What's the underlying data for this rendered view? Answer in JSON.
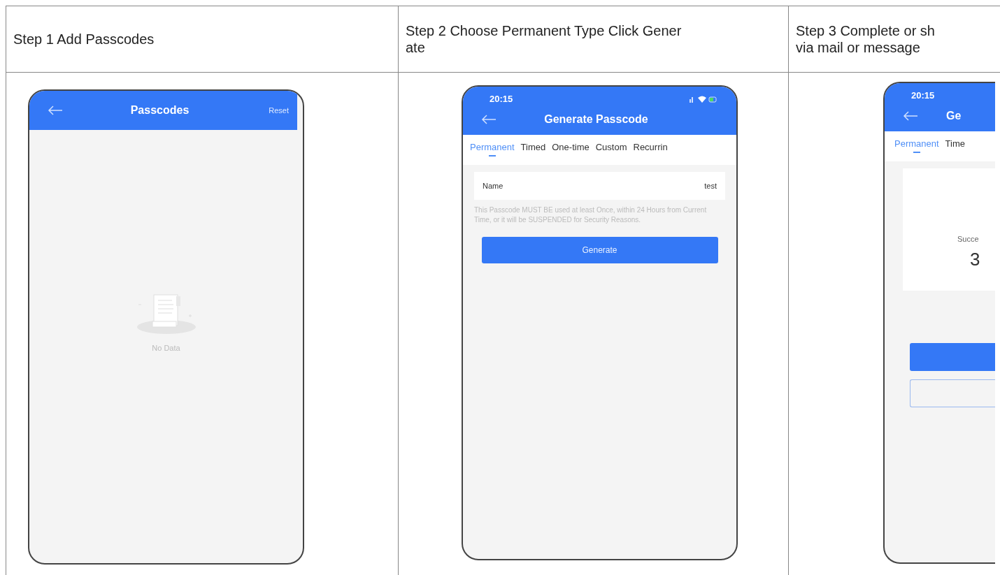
{
  "table": {
    "columns": [
      {
        "header": [
          "Step 1 Add Passcodes"
        ],
        "screen": {
          "kind": "empty_list",
          "title": "Passcodes",
          "action": "Reset",
          "empty_text": "No Data"
        }
      },
      {
        "header": [
          "Step 2 Choose Permanent Type Click Gener",
          "ate"
        ],
        "screen": {
          "kind": "form",
          "time": "20:15",
          "title": "Generate Passcode",
          "tabs": [
            {
              "label": "Permanent",
              "selected": true
            },
            {
              "label": "Timed",
              "selected": false
            },
            {
              "label": "One-time",
              "selected": false
            },
            {
              "label": "Custom",
              "selected": false
            },
            {
              "label": "Recurrin",
              "selected": false
            }
          ],
          "name_label": "Name",
          "name_value": "test",
          "note": "This Passcode MUST BE used at least Once, within 24 Hours from Current Time, or it will be SUSPENDED for Security Reasons.",
          "button": "Generate"
        }
      },
      {
        "header": [
          "Step 3 Complete or sh",
          "via mail or message"
        ],
        "screen": {
          "kind": "result",
          "time": "20:15",
          "title": "Ge",
          "tabs": [
            {
              "label": "Permanent",
              "selected": true
            },
            {
              "label": "Time",
              "selected": false
            }
          ],
          "success_text": "Succe",
          "passcode": "3"
        }
      }
    ]
  }
}
